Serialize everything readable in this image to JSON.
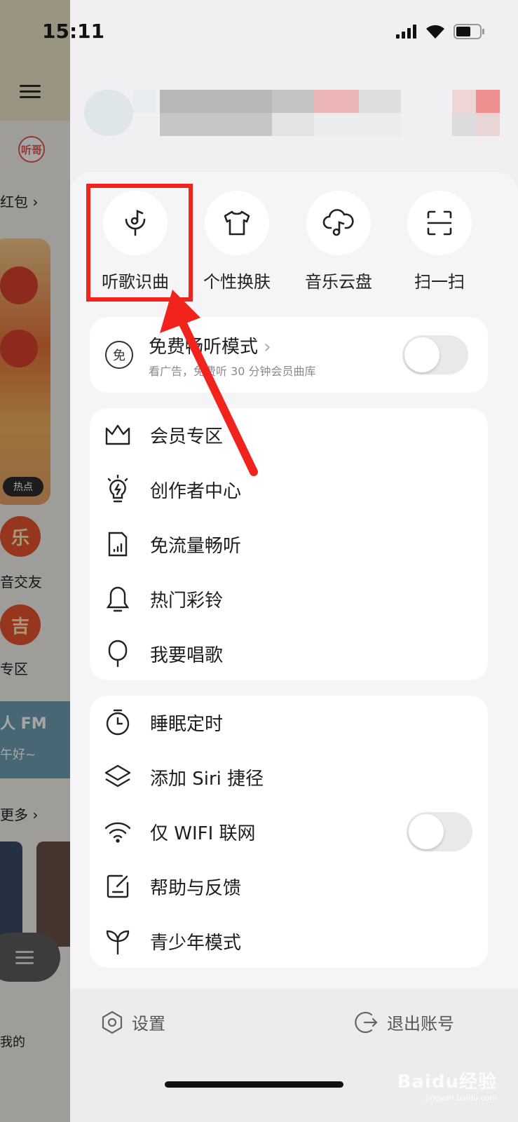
{
  "status_bar": {
    "time": "15:11"
  },
  "background_app": {
    "labels": {
      "red_packet": "红包",
      "hot_badge": "热点",
      "circle_1": "乐",
      "social": "音交友",
      "circle_2": "吉",
      "zone": "专区",
      "fm": "人 FM",
      "fm_sub": "午好~",
      "more": "更多",
      "mine": "我的",
      "logo": "听哥"
    }
  },
  "drawer": {
    "quick_actions": [
      {
        "label": "听歌识曲",
        "icon": "music-recognition-icon"
      },
      {
        "label": "个性换肤",
        "icon": "tshirt-icon"
      },
      {
        "label": "音乐云盘",
        "icon": "cloud-music-icon"
      },
      {
        "label": "扫一扫",
        "icon": "scan-icon"
      }
    ],
    "free_listen": {
      "title": "免费畅听模式",
      "subtitle": "看广告，免费听 30 分钟会员曲库",
      "icon_text": "免",
      "enabled": false
    },
    "group1": [
      {
        "label": "会员专区",
        "icon": "crown-icon"
      },
      {
        "label": "创作者中心",
        "icon": "lightbulb-icon"
      },
      {
        "label": "免流量畅听",
        "icon": "sim-card-icon"
      },
      {
        "label": "热门彩铃",
        "icon": "bell-icon"
      },
      {
        "label": "我要唱歌",
        "icon": "microphone-icon"
      }
    ],
    "group2": [
      {
        "label": "睡眠定时",
        "icon": "timer-icon"
      },
      {
        "label": "添加 Siri 捷径",
        "icon": "layers-icon"
      },
      {
        "label": "仅 WIFI 联网",
        "icon": "wifi-icon",
        "toggle": false
      },
      {
        "label": "帮助与反馈",
        "icon": "feedback-icon"
      },
      {
        "label": "青少年模式",
        "icon": "sprout-icon"
      }
    ],
    "bottom": {
      "settings": "设置",
      "logout": "退出账号"
    }
  },
  "watermark": {
    "main": "Baidu经验",
    "sub": "jingyan.baidu.com"
  },
  "colors": {
    "annotation_red": "#f2231d",
    "toggle_off": "#e9e9eb"
  }
}
